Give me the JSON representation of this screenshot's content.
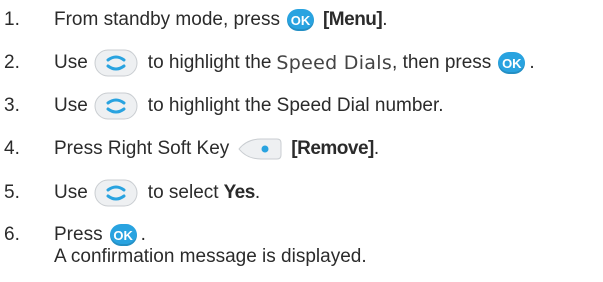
{
  "steps": [
    {
      "number": "1.",
      "text_a": "From standby mode, press",
      "button": "OK",
      "bold": "[Menu]",
      "tail": "."
    },
    {
      "number": "2.",
      "text_a": "Use",
      "text_b": "to highlight the",
      "menu_item": "Speed Dials",
      "text_c": ", then press",
      "button": "OK",
      "tail": "."
    },
    {
      "number": "3.",
      "text_a": "Use",
      "text_b": "to highlight the Speed Dial number."
    },
    {
      "number": "4.",
      "text_a": "Press Right Soft Key",
      "bold": "[Remove]",
      "tail": "."
    },
    {
      "number": "5.",
      "text_a": "Use",
      "text_b": "to select",
      "bold": "Yes",
      "tail": "."
    },
    {
      "number": "6.",
      "text_a": "Press",
      "button": "OK",
      "tail": "."
    }
  ],
  "note": "A confirmation message is displayed.",
  "icons": {
    "ok": "ok-button-icon",
    "nav": "navigation-key-icon",
    "softkey": "right-soft-key-icon"
  },
  "colors": {
    "ok_button": "#29a3e0",
    "nav_key": "#29a3e0",
    "text": "#2b2b2b"
  }
}
